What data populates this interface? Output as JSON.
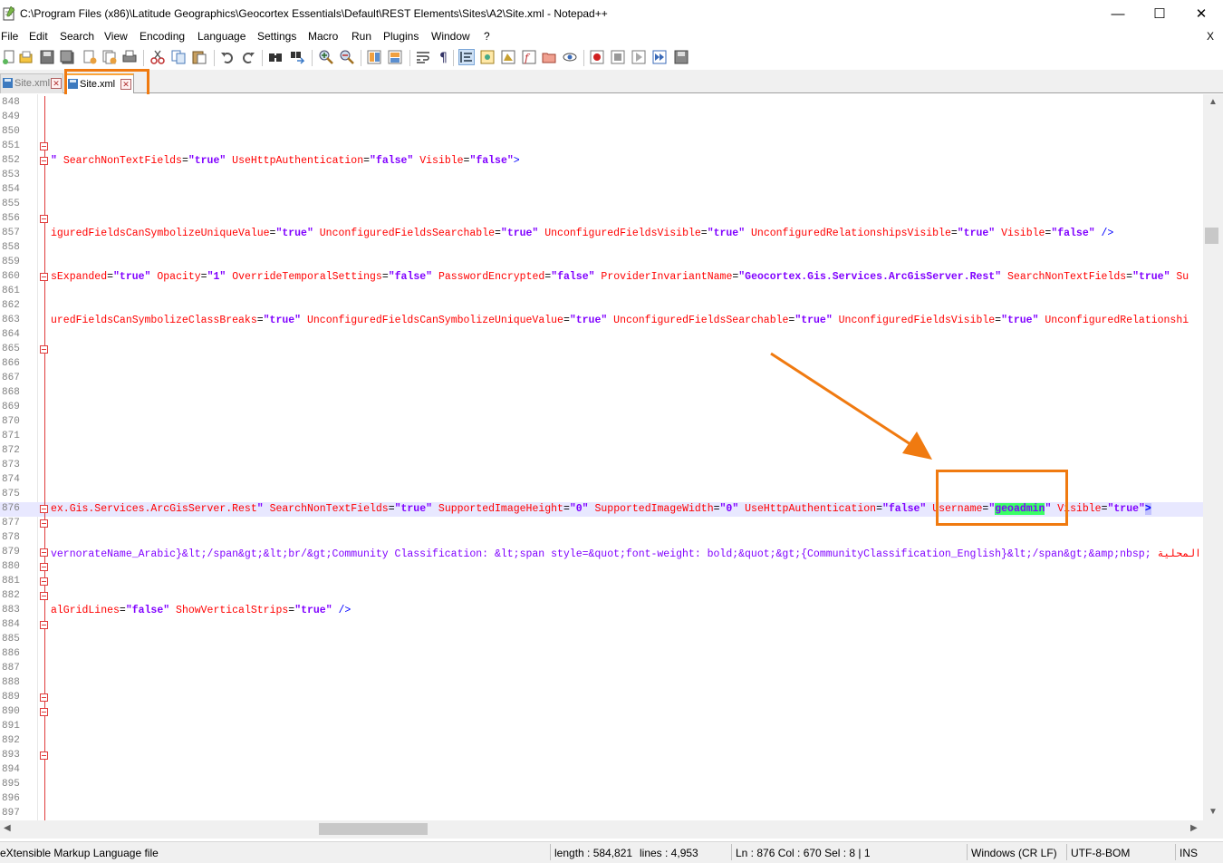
{
  "window": {
    "title": "C:\\Program Files (x86)\\Latitude Geographics\\Geocortex Essentials\\Default\\REST Elements\\Sites\\A2\\Site.xml - Notepad++",
    "minimize_glyph": "—",
    "maximize_glyph": "☐",
    "close_glyph": "✕"
  },
  "menu": {
    "items": [
      "File",
      "Edit",
      "Search",
      "View",
      "Encoding",
      "Language",
      "Settings",
      "Macro",
      "Run",
      "Plugins",
      "Window",
      "?"
    ],
    "close_glyph": "X"
  },
  "toolbar": {
    "icons": [
      "new-file-icon",
      "open-file-icon",
      "save-icon",
      "save-all-icon",
      "close-icon",
      "close-all-icon",
      "print-icon",
      "cut-icon",
      "copy-icon",
      "paste-icon",
      "undo-icon",
      "redo-icon",
      "find-icon",
      "replace-icon",
      "zoom-in-icon",
      "zoom-out-icon",
      "sync-vertical-icon",
      "sync-horizontal-icon",
      "word-wrap-icon",
      "show-all-chars-icon",
      "indent-guide-icon",
      "user-lang-icon",
      "doc-map-icon",
      "function-list-icon",
      "folder-workspace-icon",
      "monitoring-icon",
      "record-macro-icon",
      "stop-macro-icon",
      "play-macro-icon",
      "play-multiple-icon",
      "save-macro-icon"
    ]
  },
  "tabs": [
    {
      "label": "Site.xml",
      "close_glyph": "✕"
    },
    {
      "label": "Site.xml",
      "close_glyph": "✕"
    }
  ],
  "editor": {
    "lines": [
      {
        "n": "848",
        "fold": "line",
        "code": []
      },
      {
        "n": "849",
        "fold": "line",
        "code": []
      },
      {
        "n": "850",
        "fold": "line",
        "code": []
      },
      {
        "n": "851",
        "fold": "box",
        "code": []
      },
      {
        "n": "852",
        "fold": "box",
        "code": [
          [
            "val",
            "\""
          ],
          [
            "plain",
            " "
          ],
          [
            "attr",
            "SearchNonTextFields"
          ],
          [
            "plain",
            "="
          ],
          [
            "val",
            "\"true\""
          ],
          [
            "plain",
            " "
          ],
          [
            "attr",
            "UseHttpAuthentication"
          ],
          [
            "plain",
            "="
          ],
          [
            "val",
            "\"false\""
          ],
          [
            "plain",
            " "
          ],
          [
            "attr",
            "Visible"
          ],
          [
            "plain",
            "="
          ],
          [
            "val",
            "\"false\""
          ],
          [
            "tagc",
            ">"
          ]
        ]
      },
      {
        "n": "853",
        "fold": "line",
        "code": []
      },
      {
        "n": "854",
        "fold": "line",
        "code": []
      },
      {
        "n": "855",
        "fold": "line",
        "code": []
      },
      {
        "n": "856",
        "fold": "box",
        "code": []
      },
      {
        "n": "857",
        "fold": "line",
        "code": [
          [
            "attr",
            "iguredFieldsCanSymbolizeUniqueValue"
          ],
          [
            "plain",
            "="
          ],
          [
            "val",
            "\"true\""
          ],
          [
            "plain",
            " "
          ],
          [
            "attr",
            "UnconfiguredFieldsSearchable"
          ],
          [
            "plain",
            "="
          ],
          [
            "val",
            "\"true\""
          ],
          [
            "plain",
            " "
          ],
          [
            "attr",
            "UnconfiguredFieldsVisible"
          ],
          [
            "plain",
            "="
          ],
          [
            "val",
            "\"true\""
          ],
          [
            "plain",
            " "
          ],
          [
            "attr",
            "UnconfiguredRelationshipsVisible"
          ],
          [
            "plain",
            "="
          ],
          [
            "val",
            "\"true\""
          ],
          [
            "plain",
            " "
          ],
          [
            "attr",
            "Visible"
          ],
          [
            "plain",
            "="
          ],
          [
            "val",
            "\"false\""
          ],
          [
            "plain",
            " "
          ],
          [
            "tagc",
            "/>"
          ]
        ]
      },
      {
        "n": "858",
        "fold": "line",
        "code": []
      },
      {
        "n": "859",
        "fold": "line",
        "code": []
      },
      {
        "n": "860",
        "fold": "box",
        "code": [
          [
            "attr",
            "sExpanded"
          ],
          [
            "plain",
            "="
          ],
          [
            "val",
            "\"true\""
          ],
          [
            "plain",
            " "
          ],
          [
            "attr",
            "Opacity"
          ],
          [
            "plain",
            "="
          ],
          [
            "val",
            "\"1\""
          ],
          [
            "plain",
            " "
          ],
          [
            "attr",
            "OverrideTemporalSettings"
          ],
          [
            "plain",
            "="
          ],
          [
            "val",
            "\"false\""
          ],
          [
            "plain",
            " "
          ],
          [
            "attr",
            "PasswordEncrypted"
          ],
          [
            "plain",
            "="
          ],
          [
            "val",
            "\"false\""
          ],
          [
            "plain",
            " "
          ],
          [
            "attr",
            "ProviderInvariantName"
          ],
          [
            "plain",
            "="
          ],
          [
            "val",
            "\"Geocortex.Gis.Services.ArcGisServer.Rest\""
          ],
          [
            "plain",
            " "
          ],
          [
            "attr",
            "SearchNonTextFields"
          ],
          [
            "plain",
            "="
          ],
          [
            "val",
            "\"true\""
          ],
          [
            "plain",
            " "
          ],
          [
            "attr",
            "Su"
          ]
        ]
      },
      {
        "n": "861",
        "fold": "line",
        "code": []
      },
      {
        "n": "862",
        "fold": "line",
        "code": []
      },
      {
        "n": "863",
        "fold": "line",
        "code": [
          [
            "attr",
            "uredFieldsCanSymbolizeClassBreaks"
          ],
          [
            "plain",
            "="
          ],
          [
            "val",
            "\"true\""
          ],
          [
            "plain",
            " "
          ],
          [
            "attr",
            "UnconfiguredFieldsCanSymbolizeUniqueValue"
          ],
          [
            "plain",
            "="
          ],
          [
            "val",
            "\"true\""
          ],
          [
            "plain",
            " "
          ],
          [
            "attr",
            "UnconfiguredFieldsSearchable"
          ],
          [
            "plain",
            "="
          ],
          [
            "val",
            "\"true\""
          ],
          [
            "plain",
            " "
          ],
          [
            "attr",
            "UnconfiguredFieldsVisible"
          ],
          [
            "plain",
            "="
          ],
          [
            "val",
            "\"true\""
          ],
          [
            "plain",
            " "
          ],
          [
            "attr",
            "UnconfiguredRelationshi"
          ]
        ]
      },
      {
        "n": "864",
        "fold": "line",
        "code": []
      },
      {
        "n": "865",
        "fold": "box",
        "code": []
      },
      {
        "n": "866",
        "fold": "line",
        "code": []
      },
      {
        "n": "867",
        "fold": "line",
        "code": []
      },
      {
        "n": "868",
        "fold": "line",
        "code": []
      },
      {
        "n": "869",
        "fold": "line",
        "code": []
      },
      {
        "n": "870",
        "fold": "line",
        "code": []
      },
      {
        "n": "871",
        "fold": "line",
        "code": []
      },
      {
        "n": "872",
        "fold": "line",
        "code": []
      },
      {
        "n": "873",
        "fold": "line",
        "code": []
      },
      {
        "n": "874",
        "fold": "line",
        "code": []
      },
      {
        "n": "875",
        "fold": "line",
        "code": []
      },
      {
        "n": "876",
        "fold": "box",
        "current": true,
        "code": [
          [
            "attr",
            "ex.Gis.Services.ArcGisServer.Rest"
          ],
          [
            "val",
            "\""
          ],
          [
            "plain",
            " "
          ],
          [
            "attr",
            "SearchNonTextFields"
          ],
          [
            "plain",
            "="
          ],
          [
            "val",
            "\"true\""
          ],
          [
            "plain",
            " "
          ],
          [
            "attr",
            "SupportedImageHeight"
          ],
          [
            "plain",
            "="
          ],
          [
            "val",
            "\"0\""
          ],
          [
            "plain",
            " "
          ],
          [
            "attr",
            "SupportedImageWidth"
          ],
          [
            "plain",
            "="
          ],
          [
            "val",
            "\"0\""
          ],
          [
            "plain",
            " "
          ],
          [
            "attr",
            "UseHttpAuthentication"
          ],
          [
            "plain",
            "="
          ],
          [
            "val",
            "\"false\""
          ],
          [
            "plain",
            " "
          ],
          [
            "attr",
            "Username"
          ],
          [
            "plain",
            "="
          ],
          [
            "val",
            "\""
          ],
          [
            "green",
            "geoadmin"
          ],
          [
            "val",
            "\""
          ],
          [
            "plain",
            " "
          ],
          [
            "attr",
            "Visible"
          ],
          [
            "plain",
            "="
          ],
          [
            "val",
            "\"true\""
          ],
          [
            "bracket",
            ">"
          ]
        ]
      },
      {
        "n": "877",
        "fold": "box",
        "code": []
      },
      {
        "n": "878",
        "fold": "line",
        "code": []
      },
      {
        "n": "879",
        "fold": "box",
        "code": [
          [
            "val-plain",
            "vernorateName_Arabic}&lt;/span&gt;&lt;br/&gt;Community Classification: &lt;span style=&quot;font-weight: bold;&quot;&gt;{CommunityClassification_English}&lt;/span&gt;&amp;nbsp; "
          ],
          [
            "arabic",
            "المحلية"
          ]
        ]
      },
      {
        "n": "880",
        "fold": "box",
        "code": []
      },
      {
        "n": "881",
        "fold": "box",
        "code": []
      },
      {
        "n": "882",
        "fold": "box",
        "code": []
      },
      {
        "n": "883",
        "fold": "line",
        "code": [
          [
            "attr",
            "alGridLines"
          ],
          [
            "plain",
            "="
          ],
          [
            "val",
            "\"false\""
          ],
          [
            "plain",
            " "
          ],
          [
            "attr",
            "ShowVerticalStrips"
          ],
          [
            "plain",
            "="
          ],
          [
            "val",
            "\"true\""
          ],
          [
            "plain",
            " "
          ],
          [
            "tagc",
            "/>"
          ]
        ]
      },
      {
        "n": "884",
        "fold": "box",
        "code": []
      },
      {
        "n": "885",
        "fold": "line",
        "code": []
      },
      {
        "n": "886",
        "fold": "line",
        "code": []
      },
      {
        "n": "887",
        "fold": "line",
        "code": []
      },
      {
        "n": "888",
        "fold": "line",
        "code": []
      },
      {
        "n": "889",
        "fold": "box",
        "code": []
      },
      {
        "n": "890",
        "fold": "box",
        "code": []
      },
      {
        "n": "891",
        "fold": "line",
        "code": []
      },
      {
        "n": "892",
        "fold": "line",
        "code": []
      },
      {
        "n": "893",
        "fold": "box",
        "code": []
      },
      {
        "n": "894",
        "fold": "line",
        "code": []
      },
      {
        "n": "895",
        "fold": "line",
        "code": []
      },
      {
        "n": "896",
        "fold": "line",
        "code": []
      },
      {
        "n": "897",
        "fold": "line",
        "code": []
      }
    ]
  },
  "scroll": {
    "up_glyph": "▲",
    "down_glyph": "▼",
    "left_glyph": "◀",
    "right_glyph": "▶"
  },
  "status": {
    "file_type": "eXtensible Markup Language file",
    "length": "length : 584,821",
    "lines": "lines : 4,953",
    "position": "Ln : 876    Col : 670    Sel : 8 | 1",
    "eol": "Windows (CR LF)",
    "encoding": "UTF-8-BOM",
    "mode": "INS"
  },
  "annotation_color": "#f07a10"
}
